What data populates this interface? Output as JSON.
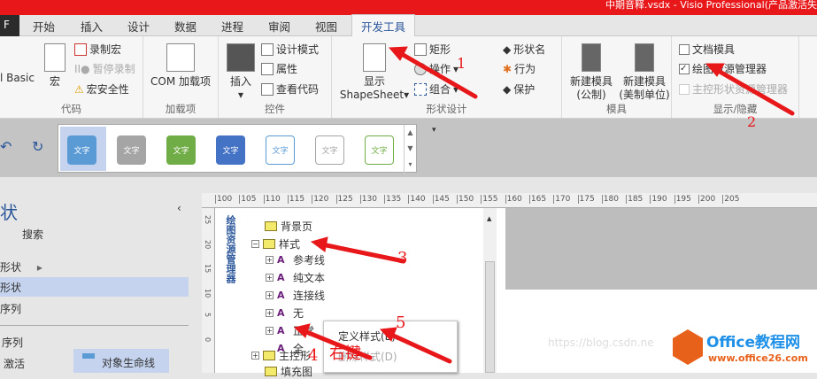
{
  "title": "中期音释.vsdx - Visio Professional(产品激活失",
  "file_tab": "F",
  "tabs": [
    "开始",
    "插入",
    "设计",
    "数据",
    "进程",
    "审阅",
    "视图",
    "开发工具"
  ],
  "ribbon": {
    "code": {
      "label": "代码",
      "vb": "l Basic",
      "macro": "宏",
      "record": "录制宏",
      "pause": "暂停录制",
      "security": "宏安全性"
    },
    "addins": {
      "label": "加载项",
      "com": "COM 加载项"
    },
    "controls": {
      "label": "控件",
      "insert": "插入",
      "design_mode": "设计模式",
      "properties": "属性",
      "view_code": "查看代码"
    },
    "shape_design": {
      "label": "形状设计",
      "show": "显示",
      "shapesheet": "ShapeSheet",
      "rect": "矩形",
      "operations": "操作",
      "group": "组合",
      "shape_name": "形状名",
      "behavior": "行为",
      "protect": "保护"
    },
    "stencil": {
      "label": "模具",
      "new_metric": "新建模具",
      "metric_sub": "(公制)",
      "new_us": "新建模具",
      "us_sub": "(美制单位)"
    },
    "show_hide": {
      "label": "显示/隐藏",
      "doc_stencil": "文档模具",
      "drawing_explorer": "绘图资源管理器",
      "master_explorer": "主控形状资源管理器",
      "drawing_explorer_checked": true,
      "doc_stencil_checked": false
    }
  },
  "gallery": {
    "swatch_text": "文字",
    "colors": [
      "#5b9bd5",
      "#a5a5a5",
      "#70ad47",
      "#4472c4",
      "#5b9bd5",
      "#a5a5a5",
      "#70ad47"
    ]
  },
  "left_panel": {
    "title": "状",
    "search": "搜索",
    "items": [
      "形状",
      "形状",
      "序列"
    ],
    "section": "序列",
    "activate": "激活",
    "lifeline": "对象生命线"
  },
  "ruler": {
    "h": [
      "100",
      "105",
      "110",
      "115",
      "120",
      "125",
      "130",
      "135",
      "140",
      "145",
      "150",
      "155",
      "160",
      "165",
      "170",
      "175",
      "180",
      "185",
      "190",
      "195",
      "200",
      "205"
    ],
    "v": [
      "25",
      "20",
      "15",
      "10",
      "5",
      "0"
    ]
  },
  "explorer": {
    "title": "绘图资源管理器",
    "tree": {
      "background": "背景页",
      "styles": "样式",
      "style_items": [
        "参考线",
        "纯文本",
        "连接线",
        "无",
        "正常",
        "全"
      ],
      "masters": "主控形",
      "fill": "填充图"
    }
  },
  "context_menu": {
    "items": [
      "定义样式(E)...",
      "删除样式(D)"
    ]
  },
  "annotations": [
    "1",
    "2",
    "3",
    "4",
    "5",
    "右键"
  ],
  "watermark": {
    "url": "https://blog.csdn.ne",
    "brand": "Office教程网",
    "site": "www.office26.com"
  }
}
